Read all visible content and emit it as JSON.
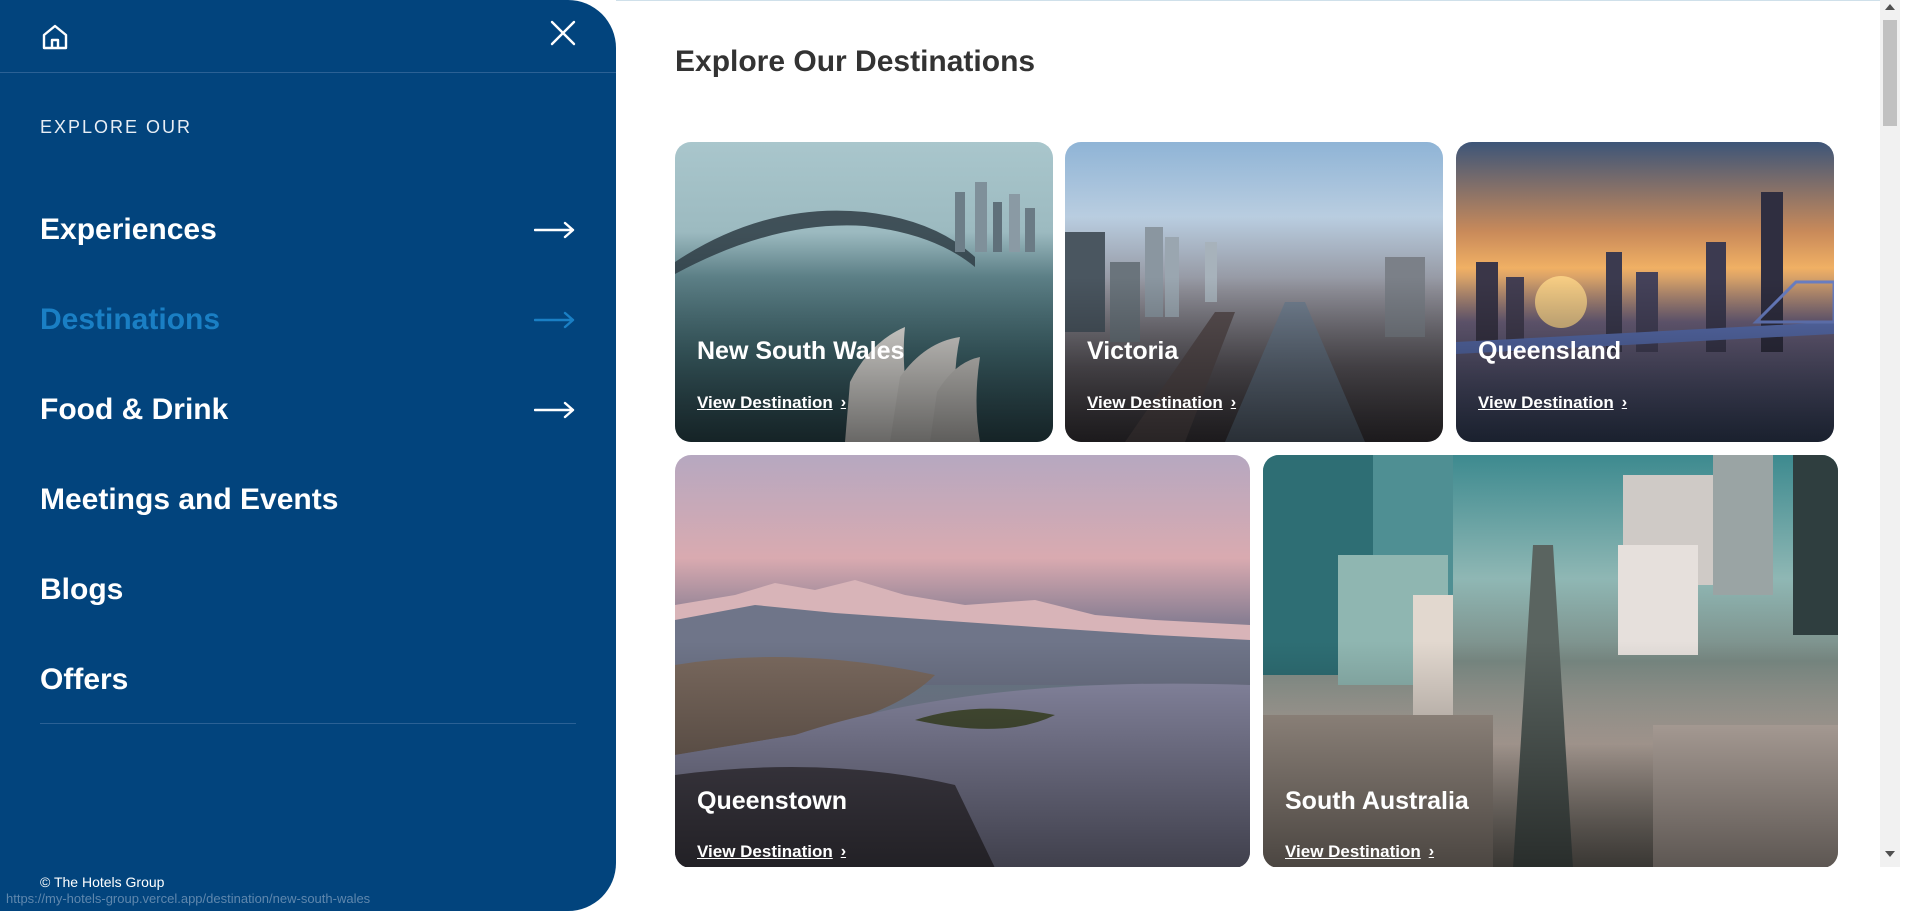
{
  "sidebar": {
    "home_icon": "home-icon",
    "close_icon": "close-icon",
    "explore_label": "EXPLORE OUR",
    "items": [
      {
        "label": "Experiences",
        "has_arrow": true,
        "active": false
      },
      {
        "label": "Destinations",
        "has_arrow": true,
        "active": true
      },
      {
        "label": "Food & Drink",
        "has_arrow": true,
        "active": false
      },
      {
        "label": "Meetings and Events",
        "has_arrow": false,
        "active": false
      },
      {
        "label": "Blogs",
        "has_arrow": false,
        "active": false
      },
      {
        "label": "Offers",
        "has_arrow": false,
        "active": false
      }
    ],
    "copyright": "© The Hotels Group",
    "background_color": "#02447d",
    "active_color": "#1a7fc4"
  },
  "status_bar": {
    "url": "https://my-hotels-group.vercel.app/destination/new-south-wales"
  },
  "main": {
    "title": "Explore Our Destinations",
    "cards": [
      {
        "name": "New South Wales",
        "link": "View Destination"
      },
      {
        "name": "Victoria",
        "link": "View Destination"
      },
      {
        "name": "Queensland",
        "link": "View Destination"
      },
      {
        "name": "Queenstown",
        "link": "View Destination"
      },
      {
        "name": "South Australia",
        "link": "View Destination"
      }
    ]
  }
}
